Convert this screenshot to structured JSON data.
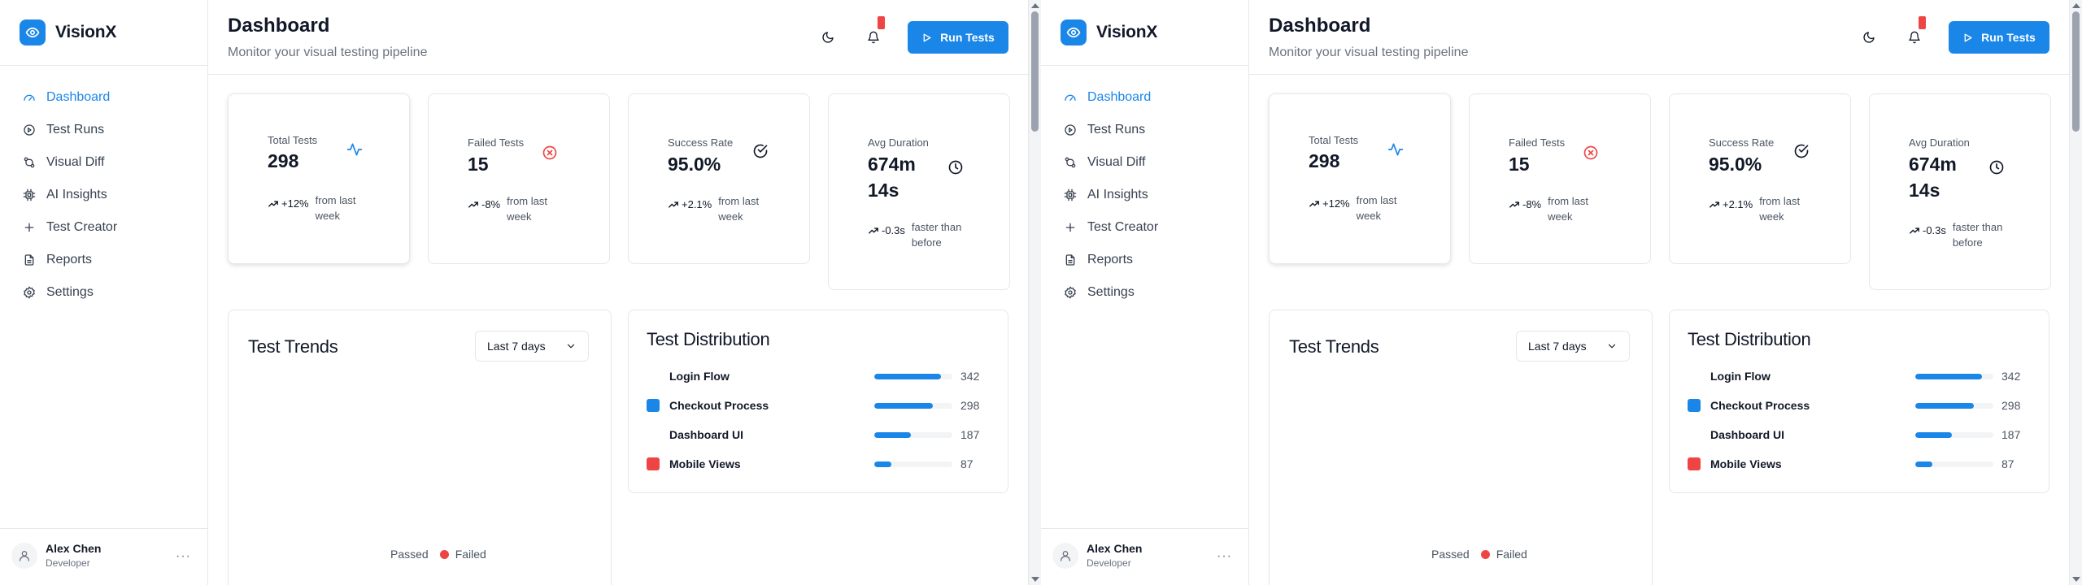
{
  "app": {
    "name": "VisionX"
  },
  "nav": [
    {
      "label": "Dashboard",
      "icon": "dashboard-icon",
      "active": true
    },
    {
      "label": "Test Runs",
      "icon": "play-circle-icon",
      "active": false
    },
    {
      "label": "Visual Diff",
      "icon": "git-compare-icon",
      "active": false
    },
    {
      "label": "AI Insights",
      "icon": "cpu-icon",
      "active": false
    },
    {
      "label": "Test Creator",
      "icon": "plus-icon",
      "active": false
    },
    {
      "label": "Reports",
      "icon": "file-icon",
      "active": false
    },
    {
      "label": "Settings",
      "icon": "gear-icon",
      "active": false
    }
  ],
  "user": {
    "name": "Alex Chen",
    "role": "Developer",
    "menu_label": "···"
  },
  "header": {
    "title": "Dashboard",
    "subtitle": "Monitor your visual testing pipeline",
    "run_label": "Run Tests"
  },
  "stats": [
    {
      "label": "Total Tests",
      "value": "298",
      "delta": "+12%",
      "note": "from last week",
      "icon": "activity-icon",
      "icon_color": "#1a86e8"
    },
    {
      "label": "Failed Tests",
      "value": "15",
      "delta": "-8%",
      "note": "from last week",
      "icon": "x-circle-icon",
      "icon_color": "#ef4444"
    },
    {
      "label": "Success Rate",
      "value": "95.0%",
      "delta": "+2.1%",
      "note": "from last week",
      "icon": "check-circle-icon",
      "icon_color": "#111827"
    },
    {
      "label": "Avg Duration",
      "value_line1": "674m",
      "value_line2": "14s",
      "delta": "-0.3s",
      "note": "faster than before",
      "icon": "clock-icon",
      "icon_color": "#111827"
    }
  ],
  "trends": {
    "title": "Test Trends",
    "range": "Last 7 days",
    "legend": [
      {
        "label": "Passed",
        "color": "#ffffff"
      },
      {
        "label": "Failed",
        "color": "#ef4444"
      }
    ]
  },
  "distribution": {
    "title": "Test Distribution",
    "max": 400,
    "rows": [
      {
        "name": "Login Flow",
        "value": 342,
        "swatch": "#ffffff"
      },
      {
        "name": "Checkout Process",
        "value": 298,
        "swatch": "#1a86e8"
      },
      {
        "name": "Dashboard UI",
        "value": 187,
        "swatch": "#ffffff"
      },
      {
        "name": "Mobile Views",
        "value": 87,
        "swatch": "#ef4444"
      }
    ]
  },
  "colors": {
    "accent": "#1a86e8",
    "danger": "#ef4444",
    "border": "#e5e7eb"
  }
}
